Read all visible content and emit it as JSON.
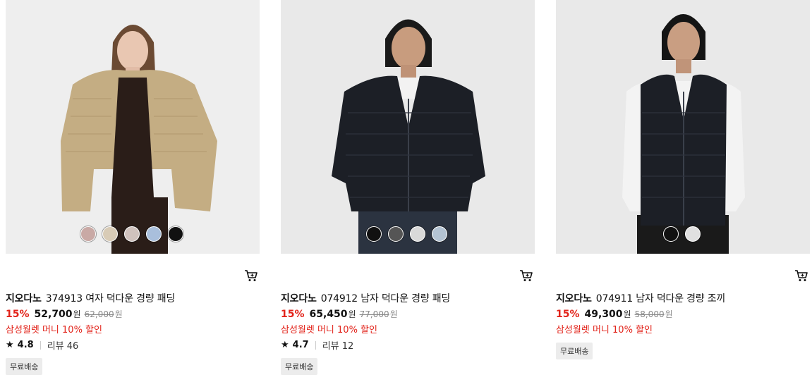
{
  "products": [
    {
      "brand": "지오다노",
      "name": "374913 여자 덕다운 경량 패딩",
      "discount": "15%",
      "price": "52,700",
      "currency": "원",
      "original_price": "62,000",
      "original_currency": "원",
      "promo": "삼성월렛 머니 10% 할인",
      "rating": "4.8",
      "review_label": "리뷰 46",
      "badge": "무료배송",
      "swatch_colors": [
        "#c9a9a5",
        "#d8cbb6",
        "#d0c2bd",
        "#a9bfdc",
        "#111111"
      ]
    },
    {
      "brand": "지오다노",
      "name": "074912 남자 덕다운 경량 패딩",
      "discount": "15%",
      "price": "65,450",
      "currency": "원",
      "original_price": "77,000",
      "original_currency": "원",
      "promo": "삼성월렛 머니 10% 할인",
      "rating": "4.7",
      "review_label": "리뷰 12",
      "badge": "무료배송",
      "swatch_colors": [
        "#111111",
        "#555555",
        "#d9d9d9",
        "#b3c3d3"
      ]
    },
    {
      "brand": "지오다노",
      "name": "074911 남자 덕다운 경량 조끼",
      "discount": "15%",
      "price": "49,300",
      "currency": "원",
      "original_price": "58,000",
      "original_currency": "원",
      "promo": "삼성월렛 머니 10% 할인",
      "badge": "무료배송",
      "swatch_colors": [
        "#111111",
        "#e0e0e0"
      ]
    }
  ],
  "icons": {
    "cart": "cart-icon",
    "star": "star-icon"
  },
  "colors": {
    "discount": "#e2231a",
    "badge_bg": "#ececec"
  }
}
